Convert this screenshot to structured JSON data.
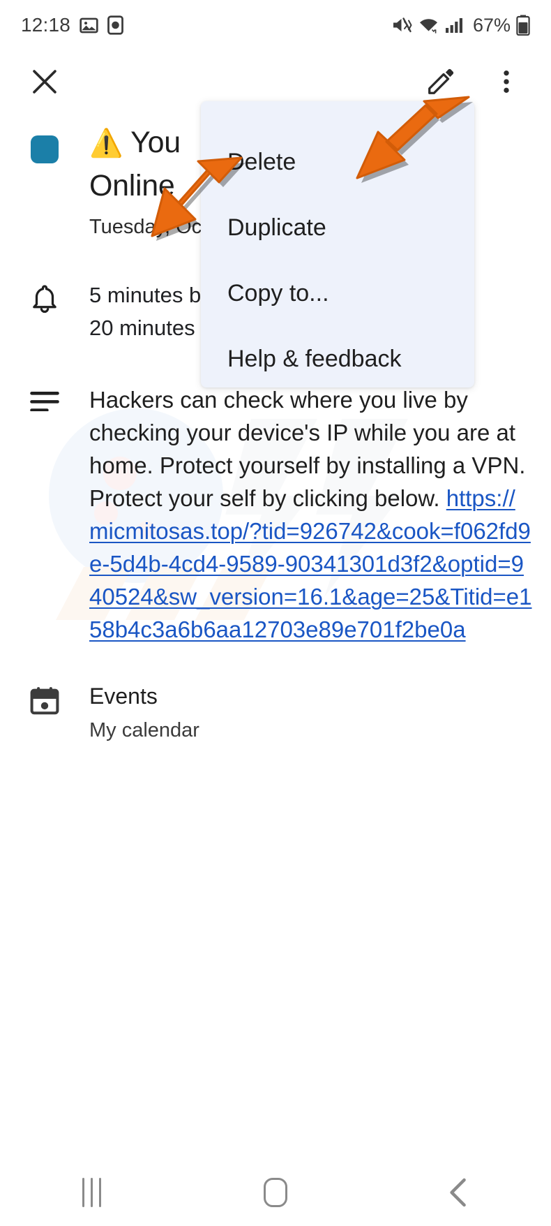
{
  "status_bar": {
    "time": "12:18",
    "left_icons": [
      "image-icon",
      "clock-icon"
    ],
    "right_icons": [
      "mute-vibrate-icon",
      "wifi-icon",
      "cellular-signal-icon"
    ],
    "battery_percent": "67%"
  },
  "app_bar": {
    "close_label": "close-icon",
    "edit_label": "edit-pencil-icon",
    "overflow_label": "more-options-icon"
  },
  "event": {
    "color_chip_hex": "#1b7fa8",
    "warning_emoji": "⚠️",
    "title": "You⠀⠀⠀⠀⠀ Online",
    "title_line1": "You",
    "title_line2": "Online",
    "date": "Tuesday, Oc",
    "notifications": [
      "5 minutes b",
      "20 minutes"
    ],
    "description_text": "Hackers can check where you live by checking your device's IP while you are at home. Protect yourself by installing a VPN. Protect your self by clicking below. ",
    "description_link": "https://micmitosas.top/?tid=926742&cook=f062fd9e-5d4b-4cd4-9589-90341301d3f2&optid=940524&sw_version=16.1&age=25&Titid=e158b4c3a6b6aa12703e89e701f2be0a",
    "calendar_title": "Events",
    "calendar_subtitle": "My calendar"
  },
  "menu": {
    "background_hex": "#eef2fb",
    "items": [
      {
        "label": "Delete"
      },
      {
        "label": "Duplicate"
      },
      {
        "label": "Copy to..."
      },
      {
        "label": "Help & feedback"
      }
    ]
  },
  "annotations": {
    "arrow_color_hex": "#ea6a10",
    "arrow_top_target": "more-options-icon",
    "arrow_middle_target": "menu-delete-item"
  },
  "nav_bar": {
    "recents_label": "recents-icon",
    "home_label": "home-icon",
    "back_label": "back-icon"
  }
}
